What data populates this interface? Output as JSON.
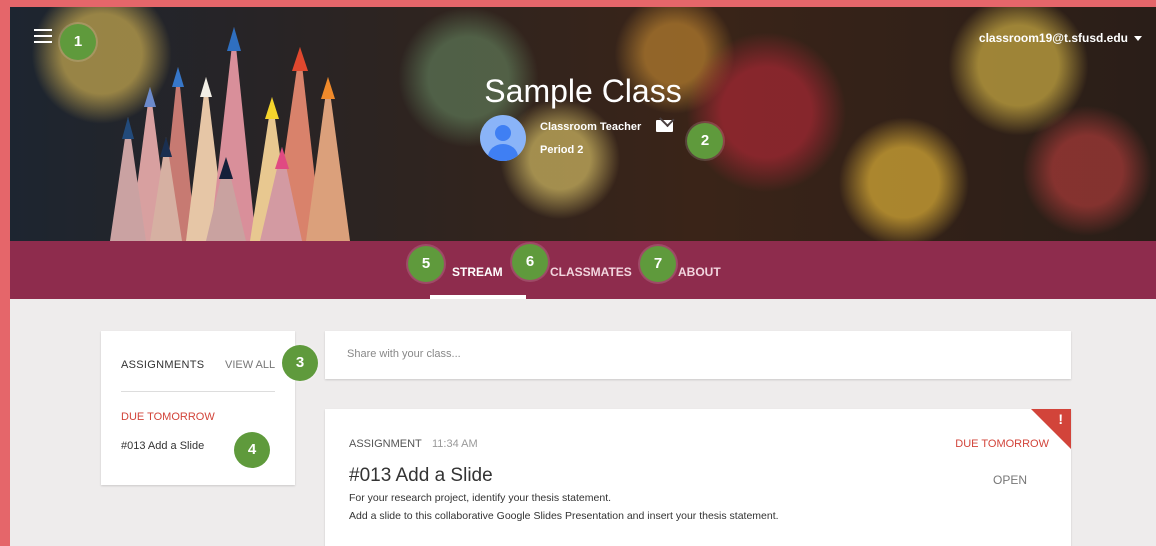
{
  "header": {
    "menu_icon": "hamburger-menu-icon",
    "account": "classroom19@t.sfusd.edu",
    "class_title": "Sample Class",
    "teacher_name": "Classroom Teacher",
    "period": "Period 2",
    "mail_icon": "mail-icon"
  },
  "badges": [
    "1",
    "2",
    "3",
    "4",
    "5",
    "6",
    "7"
  ],
  "tabs": [
    {
      "label": "STREAM",
      "active": true
    },
    {
      "label": "CLASSMATES",
      "active": false
    },
    {
      "label": "ABOUT",
      "active": false
    }
  ],
  "assignments_panel": {
    "heading": "ASSIGNMENTS",
    "view_all": "VIEW ALL",
    "due_label": "DUE TOMORROW",
    "items": [
      "#013 Add a Slide"
    ]
  },
  "share": {
    "placeholder": "Share with your class..."
  },
  "post": {
    "type": "ASSIGNMENT",
    "time": "11:34 AM",
    "due": "DUE TOMORROW",
    "title": "#013 Add a Slide",
    "open": "OPEN",
    "desc_line1": "For your research project, identify your thesis statement.",
    "desc_line2": "Add a slide to this collaborative Google Slides Presentation and insert your thesis statement.",
    "corner_mark": "!"
  },
  "colors": {
    "accent": "#8e2c4d",
    "due": "#d2443a",
    "badge": "#5f9a3c",
    "outer": "#e5666a"
  }
}
